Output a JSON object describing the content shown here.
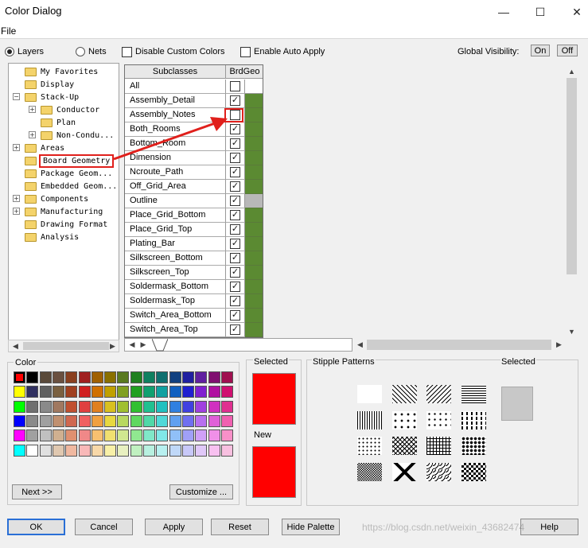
{
  "window": {
    "title": "Color Dialog",
    "minimize_glyph": "—",
    "maximize_glyph": "☐",
    "close_glyph": "✕"
  },
  "menu": {
    "file": "File"
  },
  "toolbar": {
    "layers_label": "Layers",
    "nets_label": "Nets",
    "disable_custom_colors": "Disable Custom Colors",
    "enable_auto_apply": "Enable Auto Apply",
    "global_visibility_label": "Global Visibility:",
    "on_label": "On",
    "off_label": "Off",
    "selected_mode": "Layers"
  },
  "tree": {
    "items": [
      {
        "label": "My Favorites"
      },
      {
        "label": "Display"
      },
      {
        "label": "Stack-Up",
        "expanded": true
      },
      {
        "label": "Conductor"
      },
      {
        "label": "Plan"
      },
      {
        "label": "Non-Condu..."
      },
      {
        "label": "Areas"
      },
      {
        "label": "Board Geometry",
        "selected": true
      },
      {
        "label": "Package Geom..."
      },
      {
        "label": "Embedded Geom..."
      },
      {
        "label": "Components"
      },
      {
        "label": "Manufacturing"
      },
      {
        "label": "Drawing Format"
      },
      {
        "label": "Analysis"
      }
    ]
  },
  "grid": {
    "header_name": "Subclasses",
    "header_col": "BrdGeo",
    "rows": [
      {
        "name": "All",
        "checked": false,
        "color": "#ffffff"
      },
      {
        "name": "Assembly_Detail",
        "checked": true,
        "color": "#5b8a32"
      },
      {
        "name": "Assembly_Notes",
        "checked": false,
        "color": "#5b8a32"
      },
      {
        "name": "Both_Rooms",
        "checked": true,
        "color": "#5b8a32"
      },
      {
        "name": "Bottom_Room",
        "checked": true,
        "color": "#5b8a32"
      },
      {
        "name": "Dimension",
        "checked": true,
        "color": "#5b8a32"
      },
      {
        "name": "Ncroute_Path",
        "checked": true,
        "color": "#5b8a32"
      },
      {
        "name": "Off_Grid_Area",
        "checked": true,
        "color": "#5b8a32"
      },
      {
        "name": "Outline",
        "checked": true,
        "color": "#b8b8b8"
      },
      {
        "name": "Place_Grid_Bottom",
        "checked": true,
        "color": "#5b8a32"
      },
      {
        "name": "Place_Grid_Top",
        "checked": true,
        "color": "#5b8a32"
      },
      {
        "name": "Plating_Bar",
        "checked": true,
        "color": "#5b8a32"
      },
      {
        "name": "Silkscreen_Bottom",
        "checked": true,
        "color": "#5b8a32"
      },
      {
        "name": "Silkscreen_Top",
        "checked": true,
        "color": "#5b8a32"
      },
      {
        "name": "Soldermask_Bottom",
        "checked": true,
        "color": "#5b8a32"
      },
      {
        "name": "Soldermask_Top",
        "checked": true,
        "color": "#5b8a32"
      },
      {
        "name": "Switch_Area_Bottom",
        "checked": true,
        "color": "#5b8a32"
      },
      {
        "name": "Switch_Area_Top",
        "checked": true,
        "color": "#5b8a32"
      }
    ]
  },
  "color_panel": {
    "label": "Color",
    "rows": [
      [
        "#ff0000",
        "#000000",
        "#5a4a3a",
        "#6a5040",
        "#8a4020",
        "#a02020",
        "#a06000",
        "#8a7000",
        "#5a7a20",
        "#208020",
        "#108060",
        "#107070",
        "#104080",
        "#2020a0",
        "#6020a0",
        "#801070",
        "#a01050"
      ],
      [
        "#ffff00",
        "#303060",
        "#606060",
        "#7a6040",
        "#a04020",
        "#d02020",
        "#d07000",
        "#c0a000",
        "#80a020",
        "#20a020",
        "#10a070",
        "#10a0a0",
        "#1060c0",
        "#2020d0",
        "#8020d0",
        "#b010a0",
        "#d01070"
      ],
      [
        "#00ff00",
        "#707070",
        "#8a8a8a",
        "#a07860",
        "#c05030",
        "#e04040",
        "#e08020",
        "#d8c020",
        "#a0c030",
        "#30c030",
        "#20c090",
        "#20c0c0",
        "#3080e0",
        "#4040e0",
        "#a040e0",
        "#d030c0",
        "#e03090"
      ],
      [
        "#0000ff",
        "#8a8a8a",
        "#a0a0a0",
        "#c09070",
        "#d06850",
        "#f06060",
        "#f0a040",
        "#e8d840",
        "#b8d860",
        "#60d860",
        "#50d8a8",
        "#50d8d8",
        "#60a0f0",
        "#7070f0",
        "#b870f0",
        "#e060d8",
        "#f060b0"
      ],
      [
        "#ff00ff",
        "#a0a0a0",
        "#c0c0c0",
        "#d0b090",
        "#e09070",
        "#f08888",
        "#f8c070",
        "#f0e070",
        "#d0e890",
        "#90e890",
        "#80e8c8",
        "#80e8e8",
        "#90c0f8",
        "#a0a0f8",
        "#d0a0f8",
        "#f090e8",
        "#f890c8"
      ],
      [
        "#00ffff",
        "#ffffff",
        "#e0e0e0",
        "#e0c8b0",
        "#f0b8a0",
        "#f8b8b8",
        "#f8d8a8",
        "#f8f0a8",
        "#e8f0c0",
        "#c0f0c0",
        "#b8f0e0",
        "#b8f0f0",
        "#c0d8f8",
        "#c8c8f8",
        "#e0c8f8",
        "#f8c0f0",
        "#f8c0e0"
      ]
    ],
    "next_button": "Next >>",
    "customize_button": "Customize ..."
  },
  "selected_panel": {
    "selected_label": "Selected",
    "selected_color": "#ff0000",
    "new_label": "New",
    "new_color": "#ff0000"
  },
  "stipple_panel": {
    "label": "Stipple Patterns",
    "selected_label": "Selected",
    "selected_color": "#c8c8c8",
    "patterns": [
      "solid-white",
      "diag-down",
      "diag-up",
      "horizontal",
      "vertical",
      "triangles",
      "plus",
      "dashes",
      "dots-sparse",
      "crosshatch-diag",
      "grid",
      "dots-dense",
      "checker-small",
      "diamond",
      "waves",
      "checker-large"
    ]
  },
  "buttons": {
    "ok": "OK",
    "cancel": "Cancel",
    "apply": "Apply",
    "reset": "Reset",
    "hide_palette": "Hide Palette",
    "help": "Help"
  },
  "watermark": "https://blog.csdn.net/weixin_43682474",
  "accent_color": "#e0201c"
}
